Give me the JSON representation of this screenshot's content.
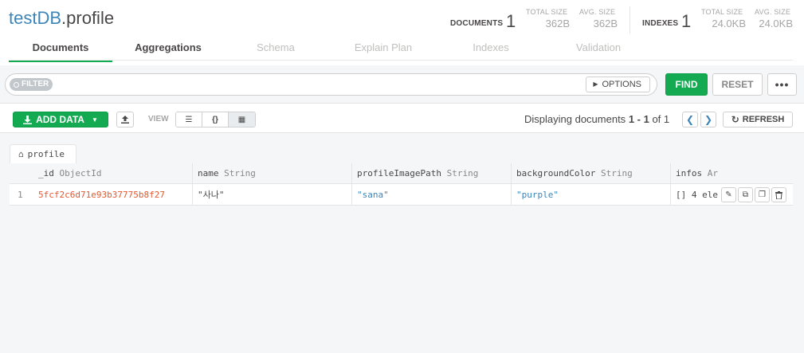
{
  "header": {
    "db": "testDB",
    "collection": ".profile",
    "documents_label": "DOCUMENTS",
    "documents_count": "1",
    "total_size_label": "TOTAL SIZE",
    "total_size": "362B",
    "avg_size_label": "AVG. SIZE",
    "avg_size": "362B",
    "indexes_label": "INDEXES",
    "indexes_count": "1",
    "idx_total_size_label": "TOTAL SIZE",
    "idx_total_size": "24.0KB",
    "idx_avg_size_label": "AVG. SIZE",
    "idx_avg_size": "24.0KB"
  },
  "tabs": [
    "Documents",
    "Aggregations",
    "Schema",
    "Explain Plan",
    "Indexes",
    "Validation"
  ],
  "filter": {
    "pill": "FILTER",
    "options": "OPTIONS",
    "find": "FIND",
    "reset": "RESET",
    "more": "•••"
  },
  "toolbar": {
    "add_data": "ADD DATA",
    "view_label": "VIEW",
    "view_list": "☰",
    "view_json": "{}",
    "view_table": "▦",
    "displaying_prefix": "Displaying documents",
    "range": "1 - 1",
    "of": "of 1",
    "refresh": "REFRESH"
  },
  "collection_tab": "profile",
  "columns": [
    {
      "name": "_id",
      "type": "ObjectId"
    },
    {
      "name": "name",
      "type": "String"
    },
    {
      "name": "profileImagePath",
      "type": "String"
    },
    {
      "name": "backgroundColor",
      "type": "String"
    },
    {
      "name": "infos",
      "type": "Ar"
    }
  ],
  "rows": [
    {
      "num": "1",
      "id": "5fcf2c6d71e93b37775b8f27",
      "name": "\"사나\"",
      "profileImagePath": "\"sana\"",
      "backgroundColor": "\"purple\"",
      "infos": "[] 4 ele"
    }
  ],
  "colors": {
    "accent": "#13aa52",
    "db_link": "#3d85b8",
    "objectid": "#e4572e",
    "string": "#3d85b8"
  }
}
